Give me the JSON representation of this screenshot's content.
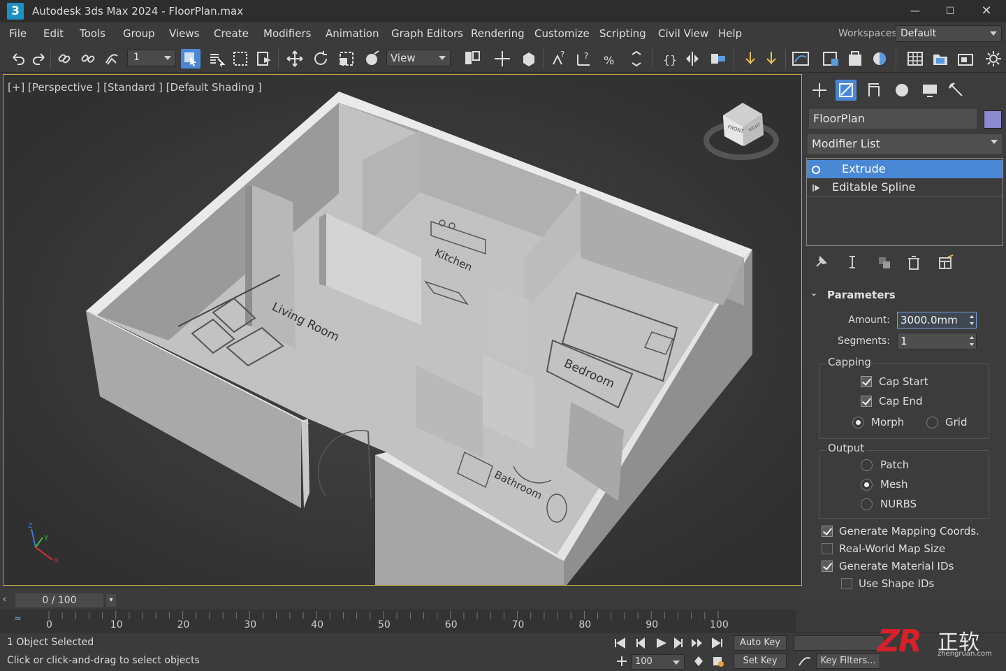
{
  "app": {
    "logo": "3",
    "title": "Autodesk 3ds Max 2024  -  FloorPlan.max"
  },
  "menu": [
    "File",
    "Edit",
    "Tools",
    "Group",
    "Views",
    "Create",
    "Modifiers",
    "Animation",
    "Graph Editors",
    "Rendering",
    "Customize",
    "Scripting",
    "Civil View",
    "Help"
  ],
  "workspaces": {
    "label": "Workspaces:",
    "value": "Default"
  },
  "toolbar": {
    "selection_filter": "1",
    "reference_coord": "View"
  },
  "viewport": {
    "label": "[+] [Perspective ] [Standard ] [Default Shading ]",
    "rooms": [
      "Living Room",
      "Kitchen",
      "Bedroom",
      "Bathroom"
    ],
    "viewcube": {
      "front": "FRONT",
      "right": "RIGHT"
    },
    "axes": {
      "x": "X",
      "y": "Y",
      "z": "Z"
    }
  },
  "command_panel": {
    "object_name": "FloorPlan",
    "object_color": "#8a8ad0",
    "modifier_list": "Modifier List",
    "stack": [
      "Extrude",
      "Editable Spline"
    ],
    "parameters": {
      "title": "Parameters",
      "amount_label": "Amount:",
      "amount_value": "3000.0mm",
      "segments_label": "Segments:",
      "segments_value": "1",
      "capping_title": "Capping",
      "cap_start": {
        "label": "Cap Start",
        "checked": true
      },
      "cap_end": {
        "label": "Cap End",
        "checked": true
      },
      "morph": {
        "label": "Morph",
        "selected": true
      },
      "grid": {
        "label": "Grid",
        "selected": false
      },
      "output_title": "Output",
      "patch": {
        "label": "Patch",
        "selected": false
      },
      "mesh": {
        "label": "Mesh",
        "selected": true
      },
      "nurbs": {
        "label": "NURBS",
        "selected": false
      },
      "gen_mapping": {
        "label": "Generate Mapping Coords.",
        "checked": true
      },
      "real_world": {
        "label": "Real-World Map Size",
        "checked": false
      },
      "gen_mat_ids": {
        "label": "Generate Material IDs",
        "checked": true
      },
      "use_shape_ids": {
        "label": "Use Shape IDs",
        "checked": false
      }
    }
  },
  "timeline": {
    "slider": "0 / 100",
    "ticks": [
      "0",
      "10",
      "20",
      "30",
      "40",
      "50",
      "60",
      "70",
      "80",
      "90",
      "100"
    ]
  },
  "status": {
    "selection": "1 Object Selected",
    "prompt": "Click or click-and-drag to select objects",
    "auto_key": "Auto Key",
    "set_key": "Set Key",
    "key_filters": "Key Filters...",
    "frame": "100"
  },
  "watermark": {
    "brand": "ZR",
    "cn": "正软",
    "url": "zhengruan.com"
  }
}
